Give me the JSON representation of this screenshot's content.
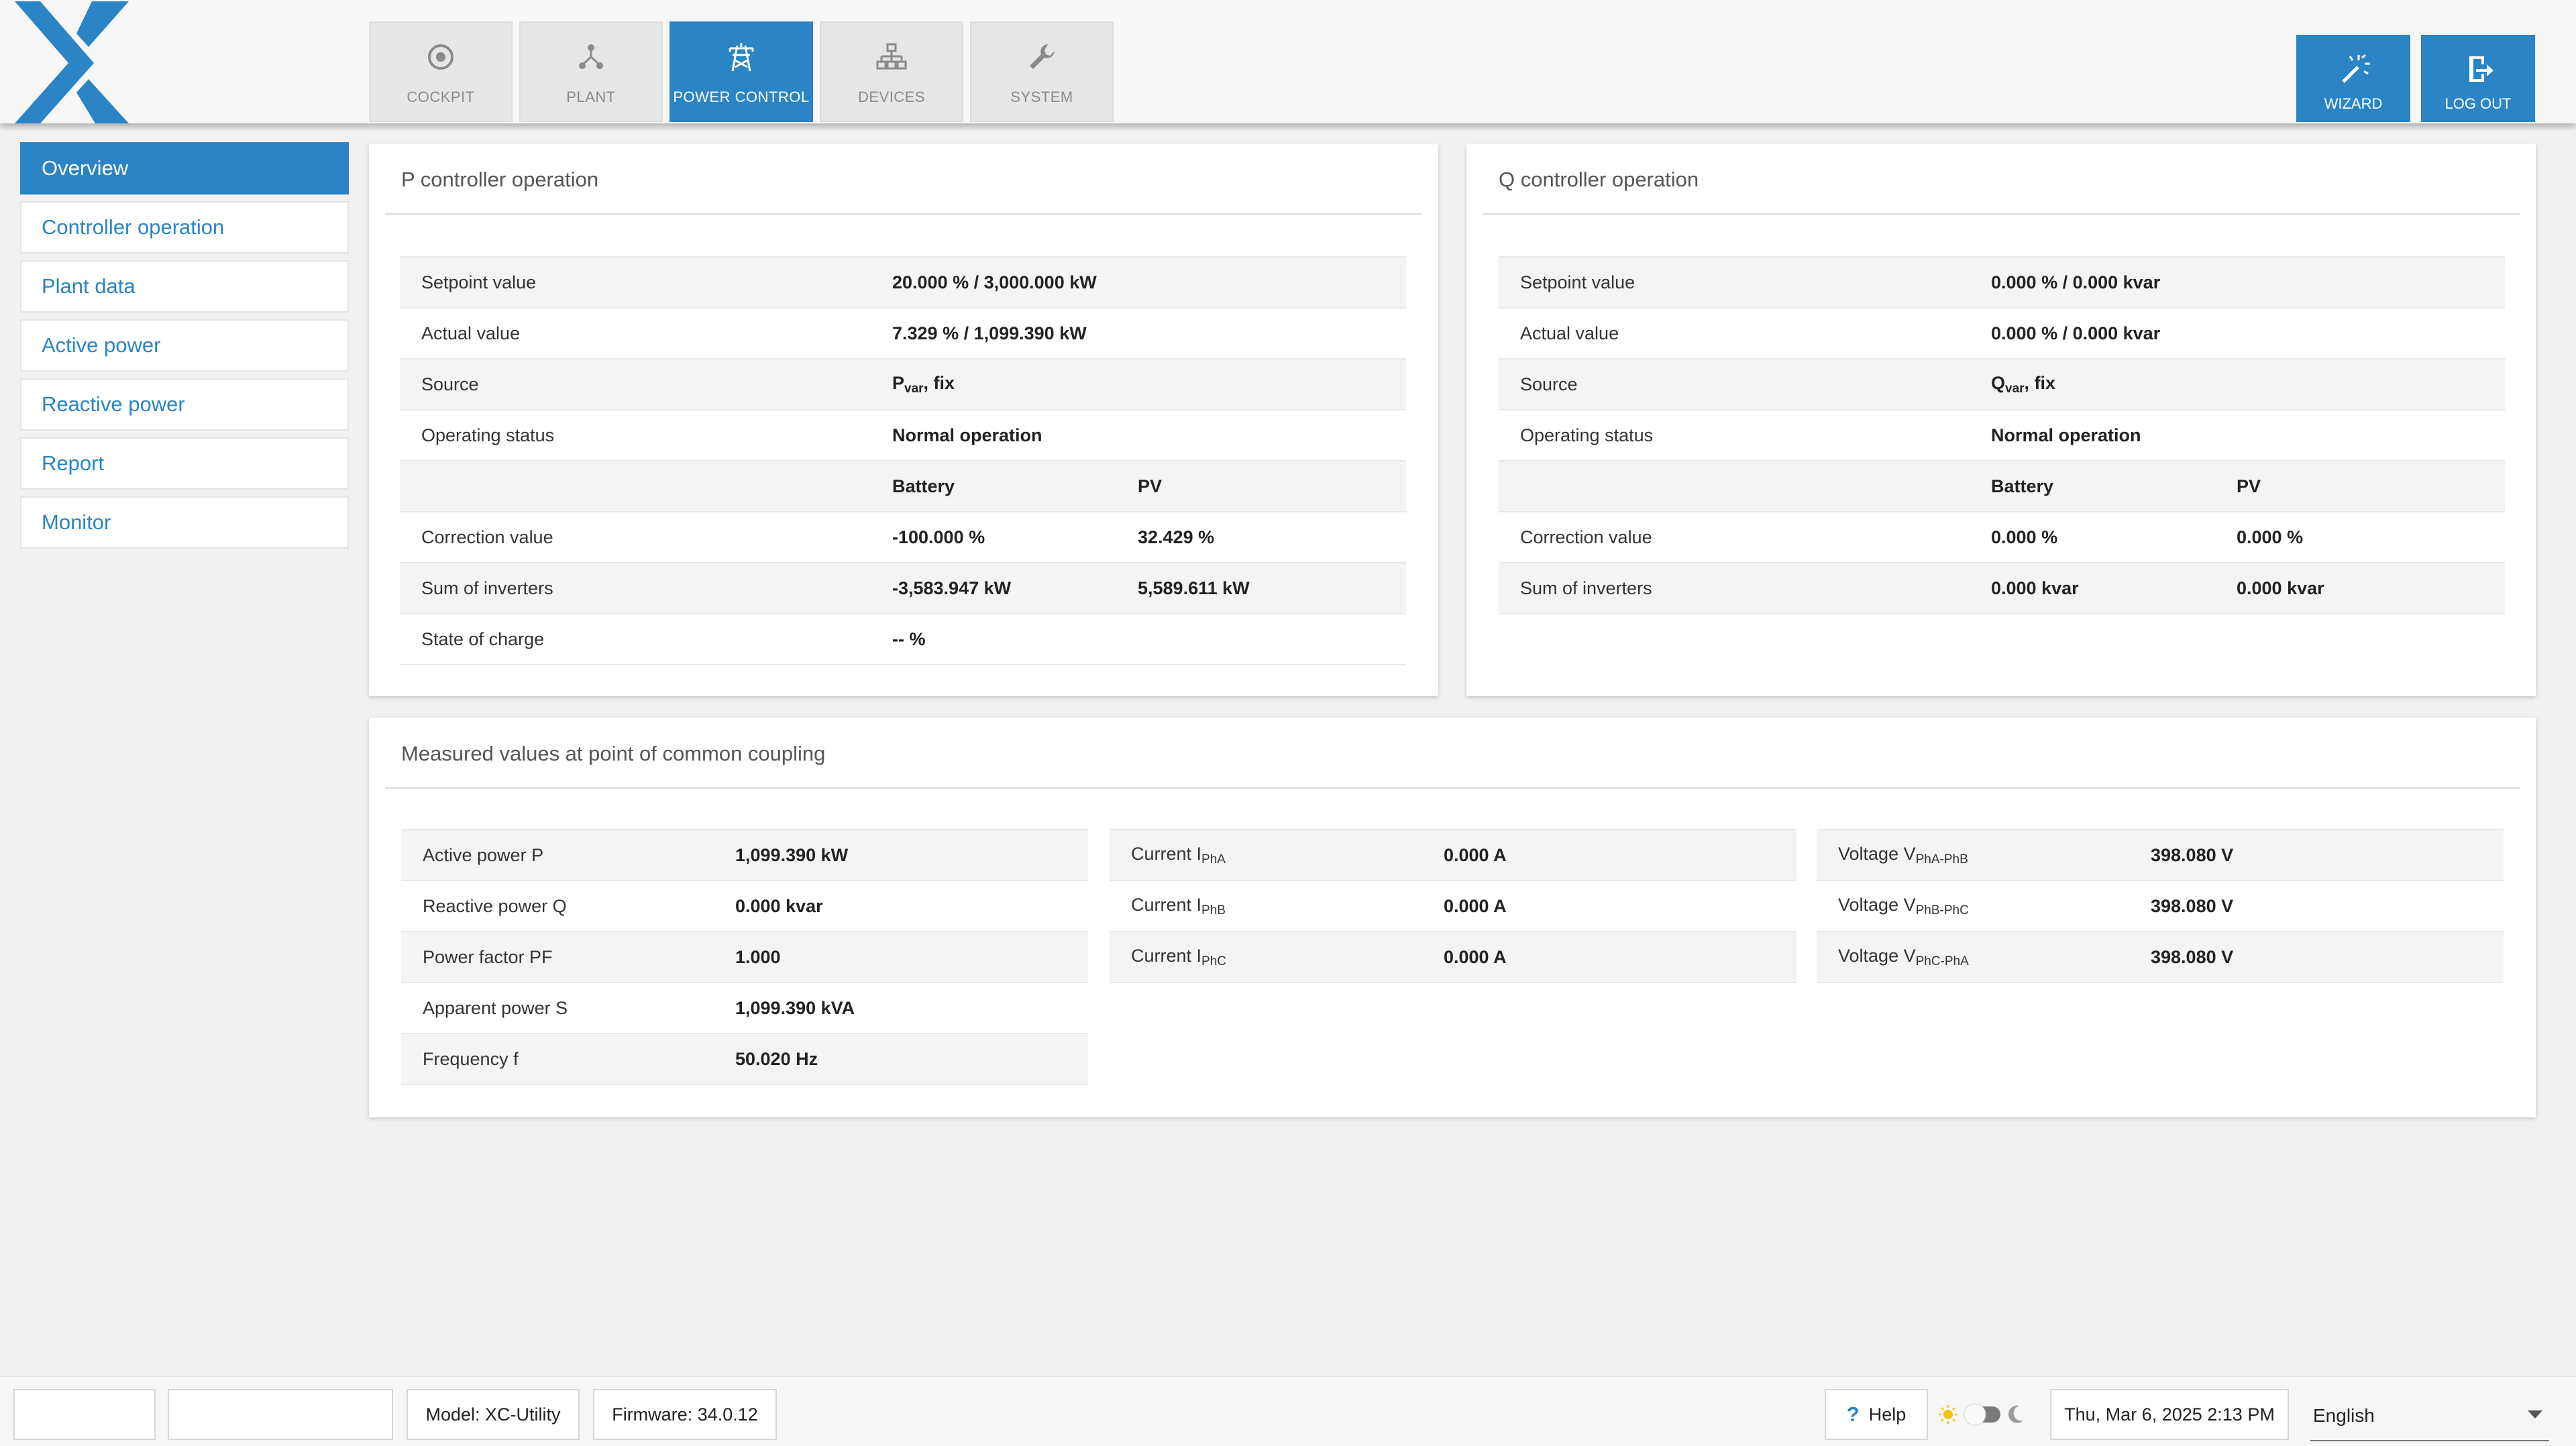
{
  "nav": {
    "tabs": [
      {
        "label": "COCKPIT",
        "icon": "target-icon"
      },
      {
        "label": "PLANT",
        "icon": "network-icon"
      },
      {
        "label": "POWER CONTROL",
        "icon": "power-tower-icon"
      },
      {
        "label": "DEVICES",
        "icon": "devices-icon"
      },
      {
        "label": "SYSTEM",
        "icon": "wrench-icon"
      }
    ],
    "active_tab": "POWER CONTROL",
    "wizard_label": "WIZARD",
    "logout_label": "LOG OUT"
  },
  "sidebar": {
    "items": [
      {
        "label": "Overview",
        "active": true
      },
      {
        "label": "Controller operation"
      },
      {
        "label": "Plant data"
      },
      {
        "label": "Active power"
      },
      {
        "label": "Reactive power"
      },
      {
        "label": "Report"
      },
      {
        "label": "Monitor"
      }
    ]
  },
  "p_controller": {
    "title": "P controller operation",
    "setpoint_label": "Setpoint value",
    "setpoint_value": "20.000 % / 3,000.000 kW",
    "actual_label": "Actual value",
    "actual_value": "7.329 % / 1,099.390 kW",
    "source_label": "Source",
    "source_main": "P",
    "source_sub": "var",
    "source_suffix": ", fix",
    "status_label": "Operating status",
    "status_value": "Normal operation",
    "col_battery": "Battery",
    "col_pv": "PV",
    "correction_label": "Correction value",
    "correction_battery": "-100.000 %",
    "correction_pv": "32.429 %",
    "sum_label": "Sum of inverters",
    "sum_battery": "-3,583.947 kW",
    "sum_pv": "5,589.611 kW",
    "soc_label": "State of charge",
    "soc_value": "-- %"
  },
  "q_controller": {
    "title": "Q controller operation",
    "setpoint_label": "Setpoint value",
    "setpoint_value": "0.000 % / 0.000 kvar",
    "actual_label": "Actual value",
    "actual_value": "0.000 % / 0.000 kvar",
    "source_label": "Source",
    "source_main": "Q",
    "source_sub": "var",
    "source_suffix": ", fix",
    "status_label": "Operating status",
    "status_value": "Normal operation",
    "col_battery": "Battery",
    "col_pv": "PV",
    "correction_label": "Correction value",
    "correction_battery": "0.000 %",
    "correction_pv": "0.000 %",
    "sum_label": "Sum of inverters",
    "sum_battery": "0.000 kvar",
    "sum_pv": "0.000 kvar"
  },
  "pcc": {
    "title": "Measured values at point of common coupling",
    "power": [
      {
        "label": "Active power P",
        "value": "1,099.390 kW"
      },
      {
        "label": "Reactive power Q",
        "value": "0.000 kvar"
      },
      {
        "label": "Power factor PF",
        "value": "1.000"
      },
      {
        "label": "Apparent power S",
        "value": "1,099.390 kVA"
      },
      {
        "label": "Frequency f",
        "value": "50.020 Hz"
      }
    ],
    "current": [
      {
        "label": "Current I",
        "sub": "PhA",
        "value": "0.000 A"
      },
      {
        "label": "Current I",
        "sub": "PhB",
        "value": "0.000 A"
      },
      {
        "label": "Current I",
        "sub": "PhC",
        "value": "0.000 A"
      }
    ],
    "voltage": [
      {
        "label": "Voltage V",
        "sub": "PhA-PhB",
        "value": "398.080 V"
      },
      {
        "label": "Voltage V",
        "sub": "PhB-PhC",
        "value": "398.080 V"
      },
      {
        "label": "Voltage V",
        "sub": "PhC-PhA",
        "value": "398.080 V"
      }
    ]
  },
  "footer": {
    "model": "Model: XC-Utility",
    "firmware": "Firmware: 34.0.12",
    "help_label": "Help",
    "datetime": "Thu, Mar 6, 2025 2:13 PM",
    "language": "English",
    "theme": "light"
  },
  "colors": {
    "accent": "#2a84c6",
    "sun": "#f0c419"
  }
}
